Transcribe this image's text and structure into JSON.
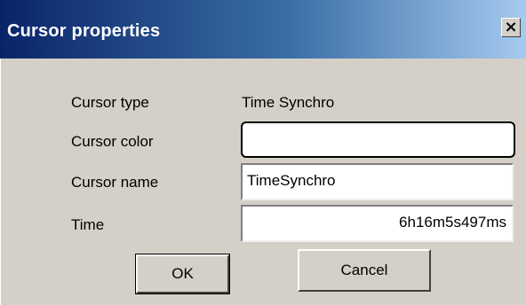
{
  "window": {
    "title": "Cursor properties",
    "close_glyph": "×"
  },
  "labels": {
    "cursor_type": "Cursor type",
    "cursor_color": "Cursor color",
    "cursor_name": "Cursor name",
    "time": "Time"
  },
  "values": {
    "cursor_type": "Time Synchro",
    "cursor_color": "",
    "cursor_name": "TimeSynchro",
    "time": "6h16m5s497ms"
  },
  "buttons": {
    "ok": "OK",
    "cancel": "Cancel"
  },
  "colors": {
    "titlebar_start": "#0a246a",
    "titlebar_end": "#a6caf0",
    "dialog_bg": "#d4d0c8"
  }
}
